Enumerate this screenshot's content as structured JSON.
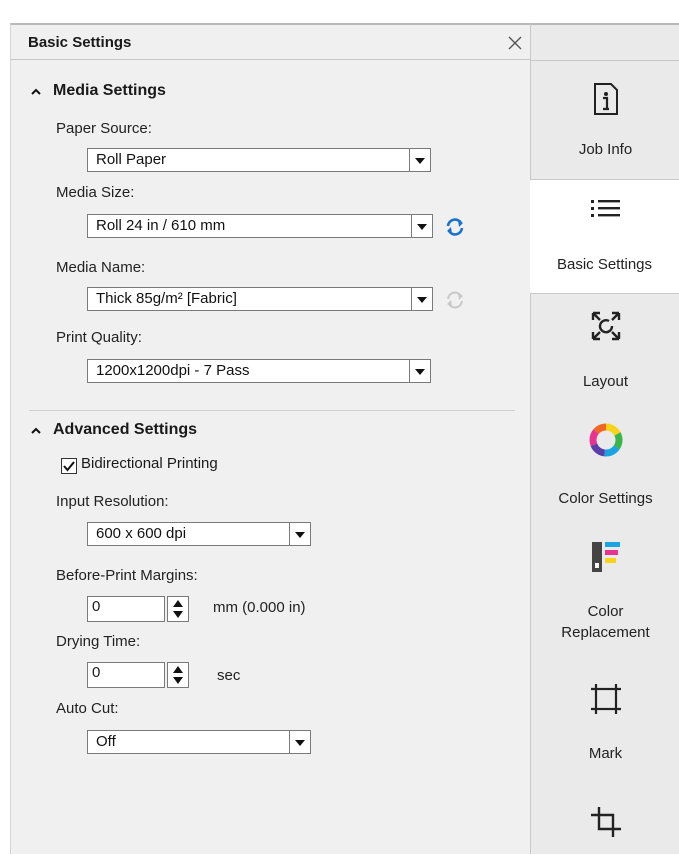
{
  "panel": {
    "title": "Basic Settings"
  },
  "media_settings": {
    "heading": "Media Settings",
    "paper_source_label": "Paper Source:",
    "paper_source_value": "Roll Paper",
    "media_size_label": "Media Size:",
    "media_size_value": "Roll 24 in / 610 mm",
    "media_name_label": "Media Name:",
    "media_name_value": "Thick 85g/m² [Fabric]",
    "print_quality_label": "Print Quality:",
    "print_quality_value": "1200x1200dpi - 7 Pass"
  },
  "advanced_settings": {
    "heading": "Advanced Settings",
    "bidirectional_label": "Bidirectional Printing",
    "bidirectional_checked": true,
    "input_resolution_label": "Input Resolution:",
    "input_resolution_value": "600 x 600 dpi",
    "margins_label": "Before-Print Margins:",
    "margins_value": "0",
    "margins_unit": "mm  (0.000 in)",
    "drying_label": "Drying Time:",
    "drying_value": "0",
    "drying_unit": "sec",
    "auto_cut_label": "Auto Cut:",
    "auto_cut_value": "Off"
  },
  "sidebar": {
    "tabs": [
      {
        "label": "Job Info",
        "icon": "info-icon",
        "active": false
      },
      {
        "label": "Basic Settings",
        "icon": "list-icon",
        "active": true
      },
      {
        "label": "Layout",
        "icon": "layout-icon",
        "active": false
      },
      {
        "label": "Color Settings",
        "icon": "color-wheel-icon",
        "active": false
      },
      {
        "label": "Color\nReplacement",
        "icon": "color-replacement-icon",
        "active": false
      },
      {
        "label": "Mark",
        "icon": "mark-icon",
        "active": false
      },
      {
        "label": "",
        "icon": "crop-icon",
        "active": false
      }
    ]
  },
  "colors": {
    "refresh_blue": "#1a73c8",
    "refresh_disabled": "#c8c8c8",
    "wheel": [
      "#f7d31a",
      "#3ab54a",
      "#1aa5e0",
      "#5b3fa8",
      "#e8338f",
      "#f26522"
    ]
  }
}
